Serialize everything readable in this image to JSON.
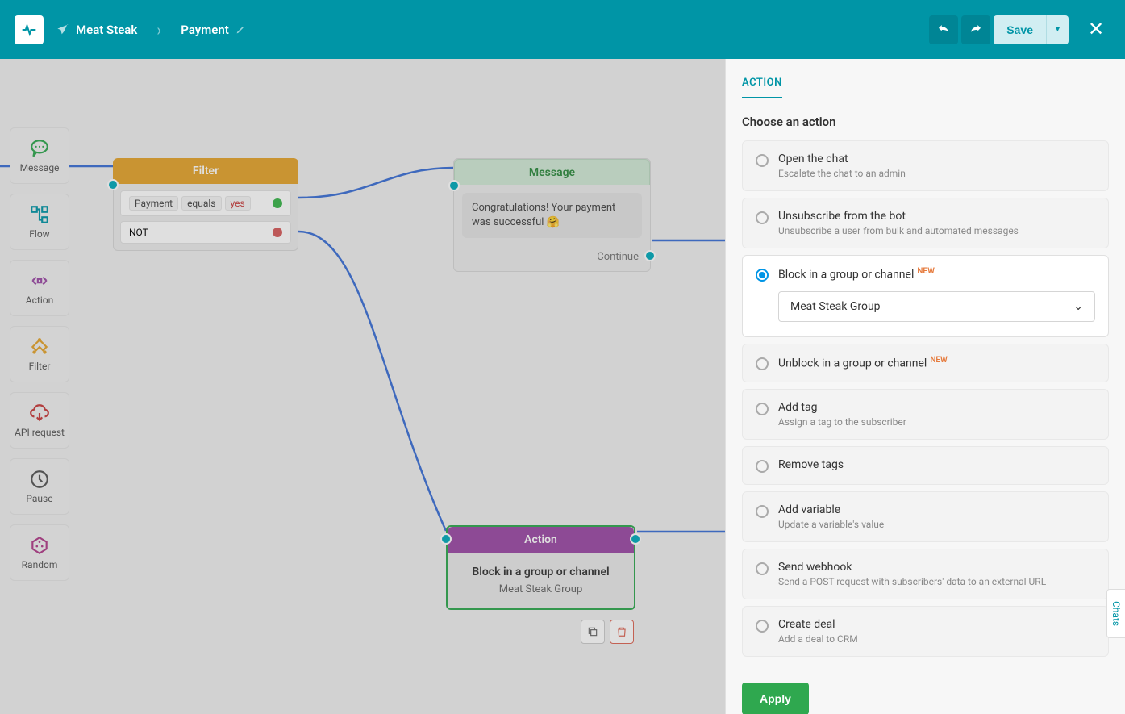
{
  "header": {
    "bot_name": "Meat Steak",
    "flow_name": "Payment",
    "save_label": "Save"
  },
  "sidebar": {
    "items": [
      {
        "label": "Message",
        "icon": "message-icon",
        "color": "#2fa84f"
      },
      {
        "label": "Flow",
        "icon": "flow-icon",
        "color": "#0095a6"
      },
      {
        "label": "Action",
        "icon": "action-icon",
        "color": "#9c4aa5"
      },
      {
        "label": "Filter",
        "icon": "filter-icon",
        "color": "#e5a42c"
      },
      {
        "label": "API request",
        "icon": "api-icon",
        "color": "#c83b3b"
      },
      {
        "label": "Pause",
        "icon": "pause-icon",
        "color": "#555"
      },
      {
        "label": "Random",
        "icon": "random-icon",
        "color": "#b13d8a"
      }
    ]
  },
  "canvas": {
    "filter_node": {
      "title": "Filter",
      "rule_field": "Payment",
      "rule_op": "equals",
      "rule_value": "yes",
      "else_label": "NOT"
    },
    "message_node": {
      "title": "Message",
      "bubble_text": "Congratulations! Your payment was successful 🤗",
      "continue_label": "Continue"
    },
    "action_node": {
      "title": "Action",
      "action_title": "Block in a group or channel",
      "action_sub": "Meat Steak Group"
    }
  },
  "panel": {
    "tab_label": "ACTION",
    "heading": "Choose an action",
    "options": [
      {
        "title": "Open the chat",
        "desc": "Escalate the chat to an admin",
        "new": false
      },
      {
        "title": "Unsubscribe from the bot",
        "desc": "Unsubscribe a user from bulk and automated messages",
        "new": false
      },
      {
        "title": "Block in a group or channel",
        "desc": "",
        "new": true,
        "selected": true,
        "select_value": "Meat Steak Group"
      },
      {
        "title": "Unblock in a group or channel",
        "desc": "",
        "new": true
      },
      {
        "title": "Add tag",
        "desc": "Assign a tag to the subscriber",
        "new": false
      },
      {
        "title": "Remove tags",
        "desc": "",
        "new": false
      },
      {
        "title": "Add variable",
        "desc": "Update a variable's value",
        "new": false
      },
      {
        "title": "Send webhook",
        "desc": "Send a POST request with subscribers' data to an external URL",
        "new": false
      },
      {
        "title": "Create deal",
        "desc": "Add a deal to CRM",
        "new": false
      }
    ],
    "new_badge": "NEW",
    "apply_label": "Apply"
  },
  "chats_tab": "Chats"
}
